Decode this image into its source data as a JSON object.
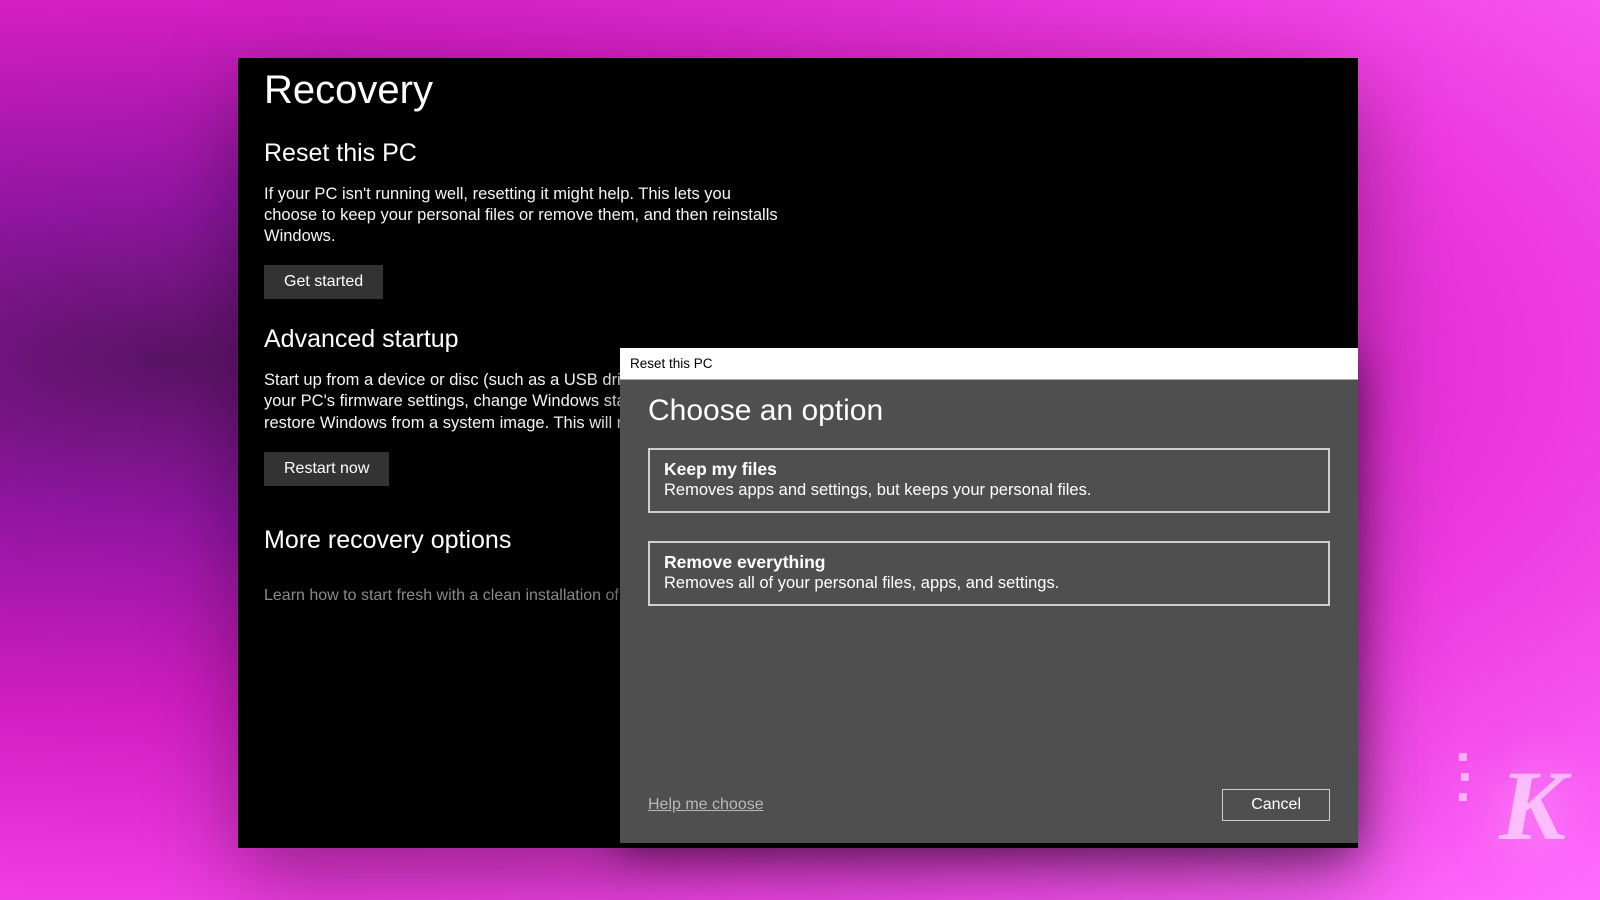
{
  "page": {
    "title": "Recovery",
    "sections": {
      "reset": {
        "heading": "Reset this PC",
        "description": "If your PC isn't running well, resetting it might help. This lets you choose to keep your personal files or remove them, and then reinstalls Windows.",
        "button": "Get started"
      },
      "advanced": {
        "heading": "Advanced startup",
        "description": "Start up from a device or disc (such as a USB drive or DVD), change your PC's firmware settings, change Windows startup settings, or restore Windows from a system image. This will restart your PC.",
        "button": "Restart now"
      },
      "more": {
        "heading": "More recovery options",
        "link": "Learn how to start fresh with a clean installation of Windows"
      }
    }
  },
  "dialog": {
    "title": "Reset this PC",
    "heading": "Choose an option",
    "options": [
      {
        "title": "Keep my files",
        "desc": "Removes apps and settings, but keeps your personal files."
      },
      {
        "title": "Remove everything",
        "desc": "Removes all of your personal files, apps, and settings."
      }
    ],
    "help": "Help me choose",
    "cancel": "Cancel"
  },
  "watermark": "K"
}
